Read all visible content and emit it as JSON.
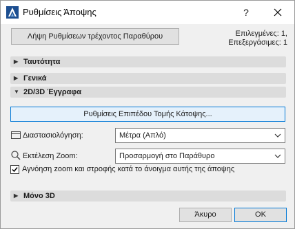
{
  "window": {
    "title": "Ρυθμίσεις Άποψης"
  },
  "titlebar": {
    "help_label": "?",
    "close_label": "✕"
  },
  "top": {
    "get_settings_label": "Λήψη Ρυθμίσεων τρέχοντος Παραθύρου",
    "selected_line": "Επιλεγμένες: 1,",
    "editable_line": "Επεξεργάσιμες: 1"
  },
  "sections": {
    "identity": "Ταυτότητα",
    "general": "Γενικά",
    "docs_2d3d": "2D/3D Έγγραφα",
    "only_3d": "Μόνο 3D"
  },
  "docs": {
    "floorplan_button": "Ρυθμίσεις Επιπέδου Τομής Κάτοψης...",
    "dimensioning_label": "Διαστασιολόγηση:",
    "dimensioning_value": "Μέτρα (Απλό)",
    "zoom_label": "Εκτέλεση Zoom:",
    "zoom_value": "Προσαρμογή στο Παράθυρο",
    "ignore_checkbox_label": "Αγνόηση zoom και στροφής κατά το άνοιγμα αυτής της άποψης",
    "ignore_checked": true
  },
  "footer": {
    "cancel_label": "Άκυρο",
    "ok_label": "OK"
  },
  "colors": {
    "accent": "#0078d7",
    "section_bg": "#dcdcdc",
    "dialog_bg": "#f0f0f0"
  }
}
